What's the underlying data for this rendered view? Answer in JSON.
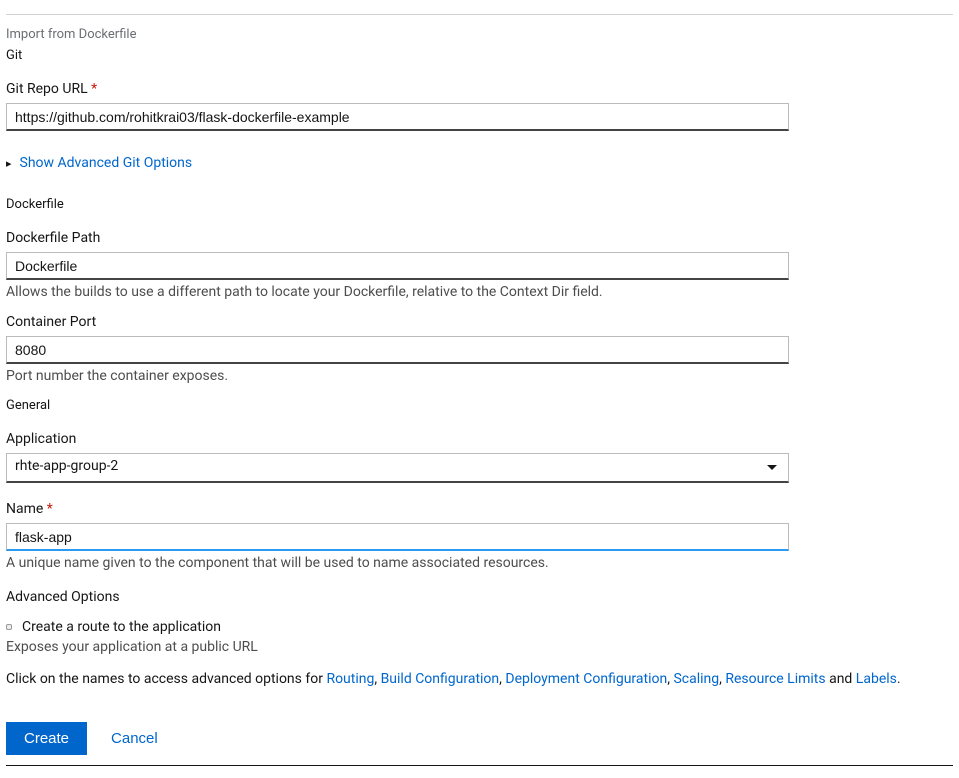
{
  "header": {
    "page_title": "Import from Dockerfile"
  },
  "git": {
    "section_label": "Git",
    "repo_url_label": "Git Repo URL",
    "repo_url_value": "https://github.com/rohitkrai03/flask-dockerfile-example",
    "advanced_toggle": "Show Advanced Git Options"
  },
  "dockerfile": {
    "section_label": "Dockerfile",
    "path_label": "Dockerfile Path",
    "path_value": "Dockerfile",
    "path_help": "Allows the builds to use a different path to locate your Dockerfile, relative to the Context Dir field.",
    "port_label": "Container Port",
    "port_value": "8080",
    "port_help": "Port number the container exposes."
  },
  "general": {
    "section_label": "General",
    "app_label": "Application",
    "app_value": "rhte-app-group-2",
    "name_label": "Name",
    "name_value": "flask-app",
    "name_help": "A unique name given to the component that will be used to name associated resources."
  },
  "advanced": {
    "section_label": "Advanced Options",
    "route_checkbox_label": "Create a route to the application",
    "route_help": "Exposes your application at a public URL",
    "prefix_text": "Click on the names to access advanced options for ",
    "links": {
      "routing": "Routing",
      "build": "Build Configuration",
      "deploy": "Deployment Configuration",
      "scaling": "Scaling",
      "limits": "Resource Limits",
      "labels": "Labels"
    },
    "and_text": " and "
  },
  "buttons": {
    "create": "Create",
    "cancel": "Cancel"
  }
}
